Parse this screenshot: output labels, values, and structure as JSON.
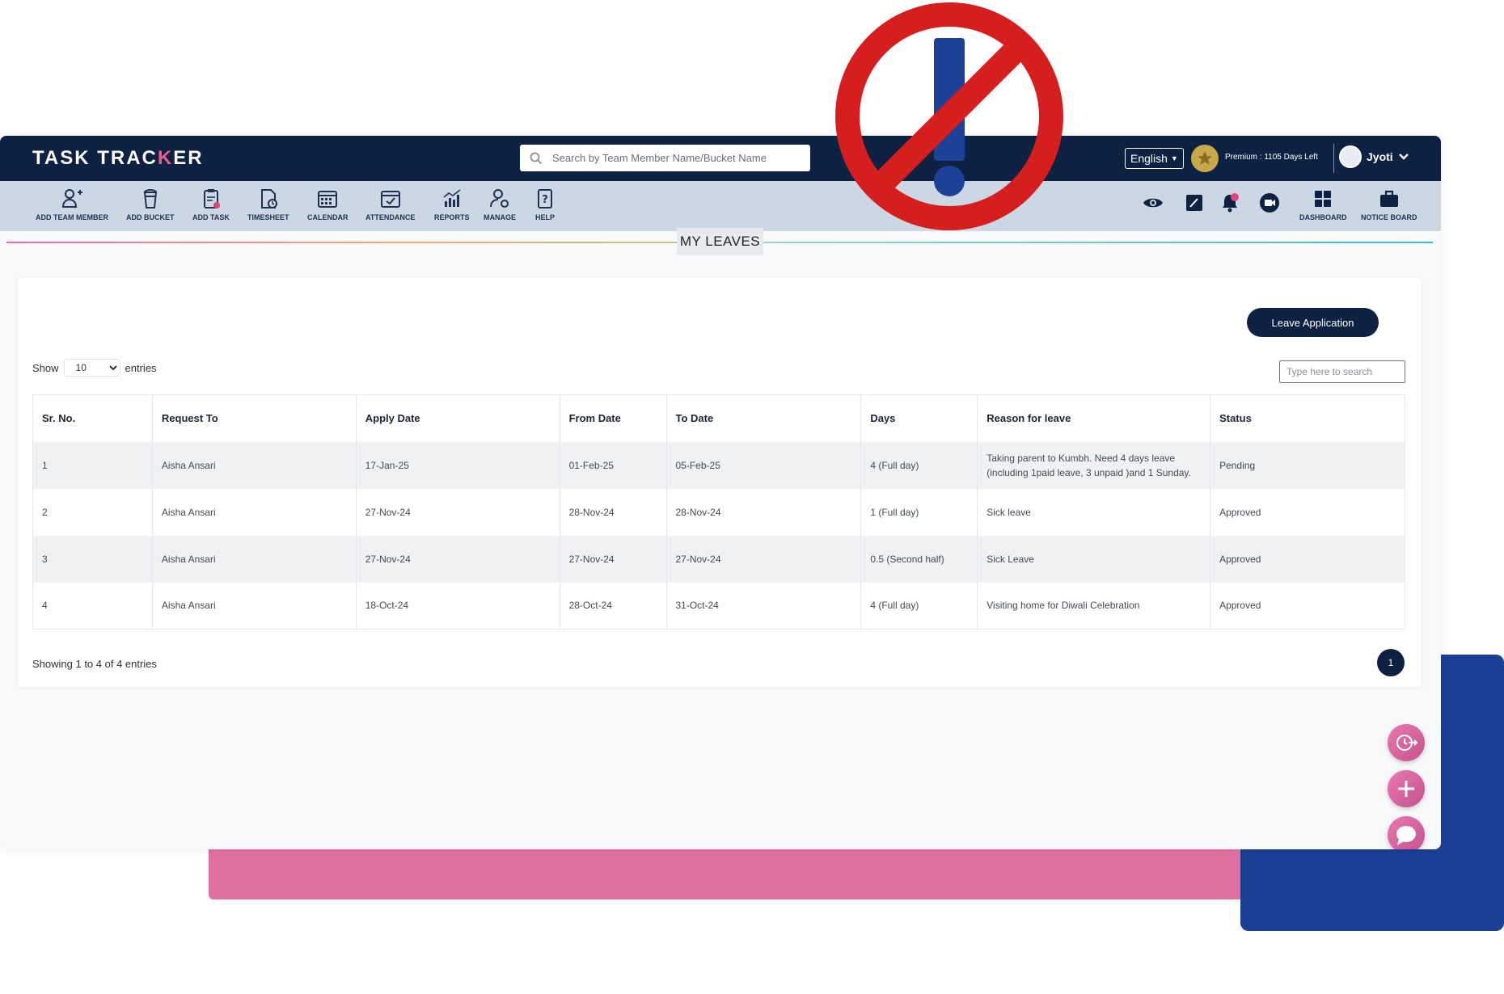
{
  "app": {
    "logo_part1": "TASK TRAC",
    "logo_accent": "K",
    "logo_part2": "ER",
    "search_placeholder": "Search by Team Member Name/Bucket Name",
    "language": "English",
    "premium_text": "Premium : 1105 Days Left",
    "user_name": "Jyoti"
  },
  "toolbar": {
    "items": [
      {
        "label": "ADD TEAM MEMBER",
        "icon": "add-user-icon"
      },
      {
        "label": "ADD BUCKET",
        "icon": "bucket-icon"
      },
      {
        "label": "ADD TASK",
        "icon": "clipboard-icon"
      },
      {
        "label": "TIMESHEET",
        "icon": "timesheet-icon"
      },
      {
        "label": "CALENDAR",
        "icon": "calendar-icon"
      },
      {
        "label": "ATTENDANCE",
        "icon": "calendar-check-icon"
      },
      {
        "label": "REPORTS",
        "icon": "bar-chart-icon"
      },
      {
        "label": "MANAGE",
        "icon": "manage-user-icon"
      },
      {
        "label": "HELP",
        "icon": "help-icon"
      }
    ],
    "right_items": [
      {
        "label": "DASHBOARD",
        "icon": "grid-icon"
      },
      {
        "label": "NOTICE BOARD",
        "icon": "briefcase-icon"
      }
    ],
    "notification_count": ""
  },
  "page": {
    "title": "MY LEAVES",
    "leave_button": "Leave Application",
    "show_label": "Show",
    "entries_label": "entries",
    "page_size": "10",
    "table_search_placeholder": "Type here to search",
    "showing_text": "Showing 1 to 4 of 4 entries",
    "current_page": "1"
  },
  "table": {
    "columns": [
      "Sr. No.",
      "Request To",
      "Apply Date",
      "From Date",
      "To Date",
      "Days",
      "Reason for leave",
      "Status"
    ],
    "rows": [
      [
        "1",
        "Aisha Ansari",
        "17-Jan-25",
        "01-Feb-25",
        "05-Feb-25",
        "4 (Full day)",
        "Taking parent to Kumbh. Need 4 days leave (including 1paid leave, 3 unpaid )and 1 Sunday.",
        "Pending"
      ],
      [
        "2",
        "Aisha Ansari",
        "27-Nov-24",
        "28-Nov-24",
        "28-Nov-24",
        "1 (Full day)",
        "Sick leave",
        "Approved"
      ],
      [
        "3",
        "Aisha Ansari",
        "27-Nov-24",
        "27-Nov-24",
        "27-Nov-24",
        "0.5 (Second half)",
        "Sick Leave",
        "Approved"
      ],
      [
        "4",
        "Aisha Ansari",
        "18-Oct-24",
        "28-Oct-24",
        "31-Oct-24",
        "4 (Full day)",
        "Visiting home for Diwali Celebration",
        "Approved"
      ]
    ]
  },
  "colors": {
    "navy": "#0d2143",
    "toolbar_bg": "#cbd7e3",
    "accent_pink": "#ee5d8a",
    "no_sign_red": "#d71e1e",
    "exclaim_blue": "#1d4196"
  }
}
